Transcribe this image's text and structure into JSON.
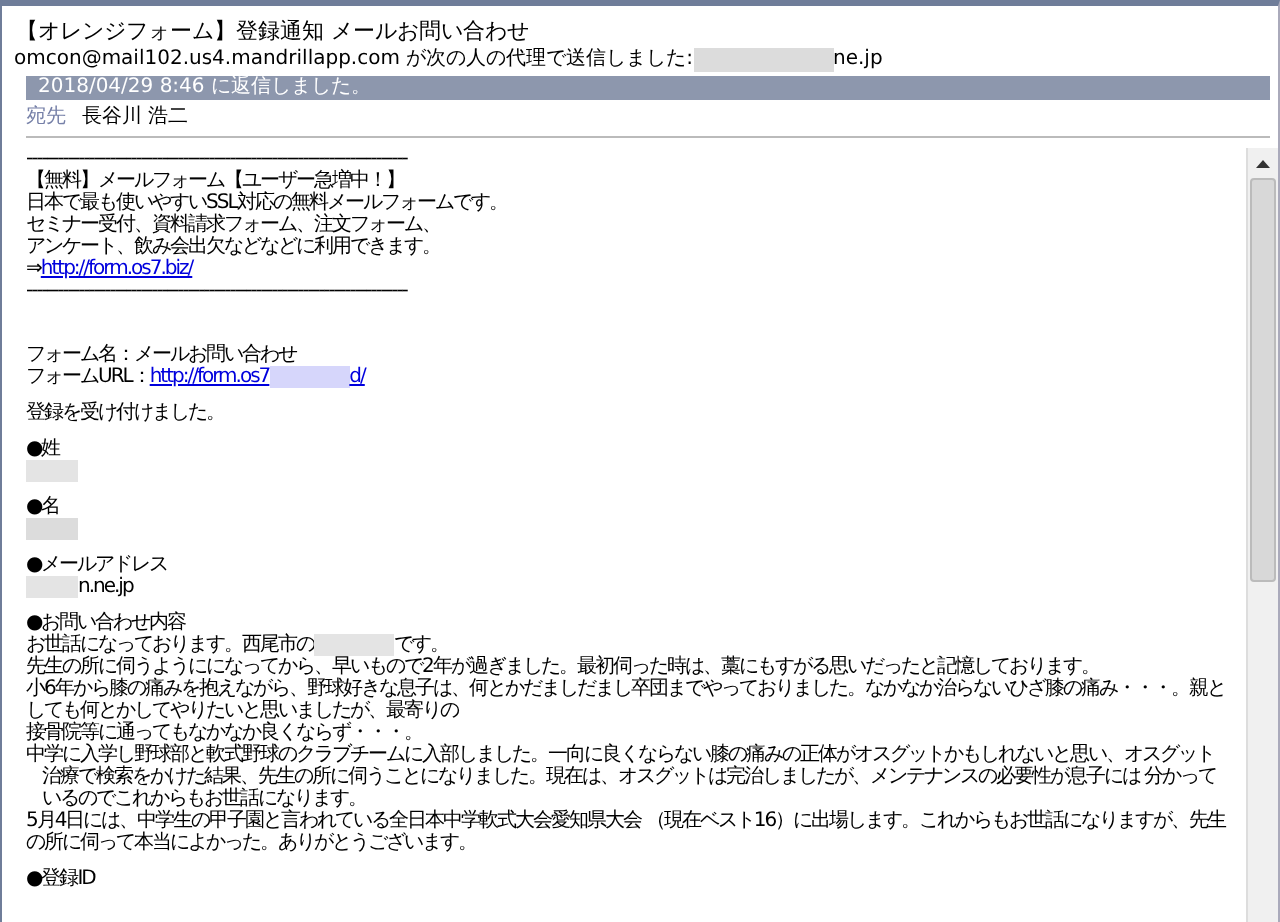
{
  "header": {
    "subject": "【オレンジフォーム】登録通知 メールお問い合わせ",
    "sender": [
      {
        "kind": "text",
        "text": "omcon@mail102.us4.mandrillapp.com が次の人の代理で送信しました:"
      },
      {
        "kind": "redacted",
        "color": "#dcdcdc"
      },
      {
        "kind": "text",
        "text": "ne.jp"
      }
    ],
    "info_bar": "2018/04/29 8:46 に返信しました。",
    "to_label": "宛先",
    "to": "長谷川 浩二"
  },
  "body": [
    {
      "kind": "line",
      "segments": [
        {
          "kind": "text",
          "text": "-------------------------------------------------------------------------"
        }
      ]
    },
    {
      "kind": "line",
      "segments": [
        {
          "kind": "text",
          "text": "【無料】メールフォーム【ユーザー急増中！】"
        }
      ]
    },
    {
      "kind": "line",
      "segments": [
        {
          "kind": "text",
          "text": "日本で最も使いやすいSSL対応の無料メールフォームです。"
        }
      ]
    },
    {
      "kind": "line",
      "segments": [
        {
          "kind": "text",
          "text": "セミナー受付、資料請求フォーム、注文フォーム、"
        }
      ]
    },
    {
      "kind": "line",
      "segments": [
        {
          "kind": "text",
          "text": "アンケート、飲み会出欠などなどに利用できます。"
        }
      ]
    },
    {
      "kind": "line",
      "segments": [
        {
          "kind": "text",
          "text": "⇒ "
        },
        {
          "kind": "link",
          "text": "http://form.os7.biz/"
        }
      ]
    },
    {
      "kind": "line",
      "segments": [
        {
          "kind": "text",
          "text": "-------------------------------------------------------------------------"
        }
      ]
    },
    {
      "kind": "blank"
    },
    {
      "kind": "blank"
    },
    {
      "kind": "blank"
    },
    {
      "kind": "line",
      "segments": [
        {
          "kind": "text",
          "text": "フォーム名：メールお問い合わせ"
        }
      ]
    },
    {
      "kind": "line",
      "segments": [
        {
          "kind": "text",
          "text": "フォームURL："
        },
        {
          "kind": "link",
          "text": "http://form.os7"
        },
        {
          "kind": "redacted",
          "color": "#d6d6fb"
        },
        {
          "kind": "link",
          "text": "d/"
        }
      ]
    },
    {
      "kind": "blank"
    },
    {
      "kind": "line",
      "segments": [
        {
          "kind": "text",
          "text": "登録を受け付けました。"
        }
      ]
    },
    {
      "kind": "blank"
    },
    {
      "kind": "line",
      "segments": [
        {
          "kind": "text",
          "text": "●姓"
        }
      ]
    },
    {
      "kind": "line",
      "segments": [
        {
          "kind": "redacted",
          "color": "#e4e4e4"
        }
      ]
    },
    {
      "kind": "blank"
    },
    {
      "kind": "line",
      "segments": [
        {
          "kind": "text",
          "text": "●名"
        }
      ]
    },
    {
      "kind": "line",
      "segments": [
        {
          "kind": "redacted",
          "color": "#dcdcdc"
        }
      ]
    },
    {
      "kind": "blank"
    },
    {
      "kind": "line",
      "segments": [
        {
          "kind": "text",
          "text": "●メールアドレス"
        }
      ]
    },
    {
      "kind": "line",
      "segments": [
        {
          "kind": "redacted",
          "color": "#e4e4e4"
        },
        {
          "kind": "text",
          "text": "n.ne.jp"
        }
      ]
    },
    {
      "kind": "blank"
    },
    {
      "kind": "line",
      "segments": [
        {
          "kind": "text",
          "text": "●お問い合わせ内容"
        }
      ]
    },
    {
      "kind": "line",
      "segments": [
        {
          "kind": "text",
          "text": "お世話になっております。西尾市の"
        },
        {
          "kind": "redacted",
          "color": "#e4e4e4"
        },
        {
          "kind": "text",
          "text": "です。"
        }
      ]
    },
    {
      "kind": "line",
      "segments": [
        {
          "kind": "text",
          "text": "先生の所に伺うようにになってから、早いもので2年が過ぎました。最初伺った時は、藁にもすがる思いだったと記憶しております。"
        }
      ]
    },
    {
      "kind": "line",
      "segments": [
        {
          "kind": "text",
          "text": "小6年から膝の痛みを抱えながら、野球好きな息子は、何とかだましだまし卒団までやっておりました。なかなか治らないひざ膝の痛み・・・。親としても何とかしてやりたいと思いましたが、最寄りの"
        }
      ]
    },
    {
      "kind": "line",
      "segments": [
        {
          "kind": "text",
          "text": "接骨院等に通ってもなかなか良くならず・・・。"
        }
      ]
    },
    {
      "kind": "line",
      "segments": [
        {
          "kind": "text",
          "text": "中学に入学し野球部と軟式野球のクラブチームに入部しました。一向に良くならない膝の痛みの正体がオスグットかもしれないと思い、オスグット"
        },
        {
          "kind": "text",
          "text": "治療で検索をかけた結果、先生の所に伺うことになりました。現在は、オスグットは完治しましたが、メンテナンスの必要性が息子には 分かっているのでこれからもお世話になります。"
        }
      ]
    },
    {
      "kind": "line",
      "segments": [
        {
          "kind": "text",
          "text": "5月4日には、中学生の甲子園と言われている全日本中学軟式大会愛知県大会 （現在ベスト16）に出場します。これからもお世話になりますが、先生の所に伺って本当によかった。ありがとうございます。"
        }
      ]
    },
    {
      "kind": "blank"
    },
    {
      "kind": "line",
      "segments": [
        {
          "kind": "text",
          "text": "●登録ID"
        }
      ]
    }
  ]
}
